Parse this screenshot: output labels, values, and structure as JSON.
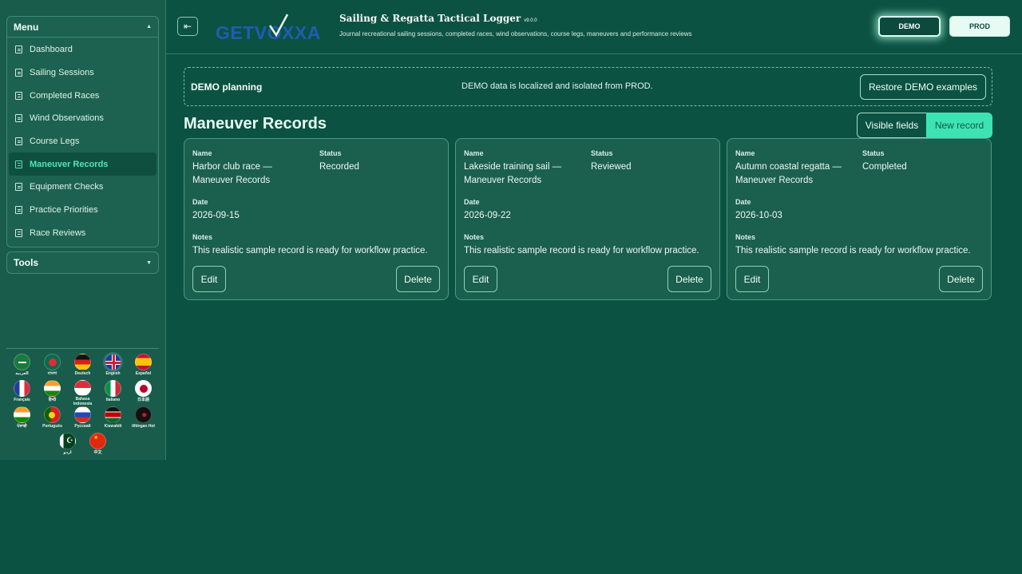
{
  "sidebar": {
    "menu_title": "Menu",
    "items": [
      {
        "label": "Dashboard"
      },
      {
        "label": "Sailing Sessions"
      },
      {
        "label": "Completed Races"
      },
      {
        "label": "Wind Observations"
      },
      {
        "label": "Course Legs"
      },
      {
        "label": "Maneuver Records"
      },
      {
        "label": "Equipment Checks"
      },
      {
        "label": "Practice Priorities"
      },
      {
        "label": "Race Reviews"
      }
    ],
    "active_item": "Maneuver Records",
    "tools_title": "Tools",
    "languages": [
      {
        "label": "العربية"
      },
      {
        "label": "বাংলা"
      },
      {
        "label": "Deutsch"
      },
      {
        "label": "English"
      },
      {
        "label": "Español"
      },
      {
        "label": "Français"
      },
      {
        "label": "हिन्दी"
      },
      {
        "label": "Bahasa Indonesia"
      },
      {
        "label": "Italiano"
      },
      {
        "label": "日本語"
      },
      {
        "label": "ਪੰਜਾਬੀ"
      },
      {
        "label": "Português"
      },
      {
        "label": "Русский"
      },
      {
        "label": "Kiswahili"
      },
      {
        "label": "tlhIngan Hol"
      },
      {
        "label": "اردو"
      },
      {
        "label": "中文"
      }
    ],
    "selected_language": "English"
  },
  "header": {
    "logo_text": "GETVOXXA",
    "title": "Sailing & Regatta Tactical Logger",
    "version": "v9.0.0",
    "subtitle": "Journal recreational sailing sessions, completed races, wind observations, course legs, maneuvers and performance reviews",
    "env_demo": "DEMO",
    "env_prod": "PROD",
    "active_env": "DEMO"
  },
  "banner": {
    "title": "DEMO planning",
    "message": "DEMO data is localized and isolated from PROD.",
    "restore_label": "Restore DEMO examples"
  },
  "main": {
    "section_title": "Maneuver Records",
    "visible_fields_label": "Visible fields",
    "new_record_label": "New record",
    "field_labels": {
      "name": "Name",
      "status": "Status",
      "date": "Date",
      "notes": "Notes"
    },
    "edit_label": "Edit",
    "delete_label": "Delete",
    "records": [
      {
        "name_line1": "Harbor club race —",
        "name_line2": "Maneuver Records",
        "status": "Recorded",
        "date": "2026-09-15",
        "notes": "This realistic sample record is ready for workflow practice."
      },
      {
        "name_line1": "Lakeside training sail —",
        "name_line2": "Maneuver Records",
        "status": "Reviewed",
        "date": "2026-09-22",
        "notes": "This realistic sample record is ready for workflow practice."
      },
      {
        "name_line1": "Autumn coastal regatta —",
        "name_line2": "Maneuver Records",
        "status": "Completed",
        "date": "2026-10-03",
        "notes": "This realistic sample record is ready for workflow practice."
      }
    ]
  },
  "colors": {
    "background": "#0b5242",
    "sidebar": "#195c4b",
    "accent": "#3ee3b4",
    "active_text": "#4ee6b9"
  }
}
